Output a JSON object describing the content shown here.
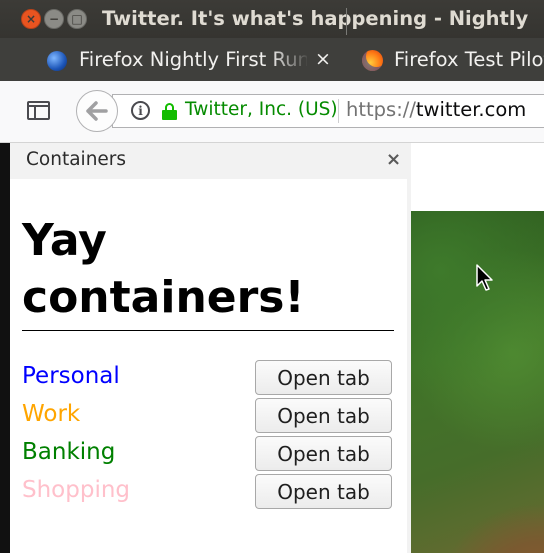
{
  "window": {
    "title": "Twitter. It's what's happening - Nightly",
    "close_glyph": "×",
    "minimize_glyph": "−",
    "maximize_glyph": "□"
  },
  "tabs": [
    {
      "label": "Firefox Nightly First Run Page",
      "icon": "globe-icon",
      "close_glyph": "×"
    },
    {
      "label": "Firefox Test Pilot",
      "icon": "firefox-icon"
    }
  ],
  "navbar": {
    "back_glyph": "🡐",
    "info_glyph": "i",
    "identity": "Twitter, Inc. (US)",
    "url_scheme": "https://",
    "url_host": "twitter.com"
  },
  "sidebar": {
    "title": "Containers",
    "close_glyph": "×",
    "heading": "Yay containers!",
    "containers": [
      {
        "name": "Personal",
        "color": "#0000ff",
        "button": "Open tab"
      },
      {
        "name": "Work",
        "color": "#ffa500",
        "button": "Open tab"
      },
      {
        "name": "Banking",
        "color": "#008000",
        "button": "Open tab"
      },
      {
        "name": "Shopping",
        "color": "#ffc0cb",
        "button": "Open tab"
      }
    ]
  }
}
